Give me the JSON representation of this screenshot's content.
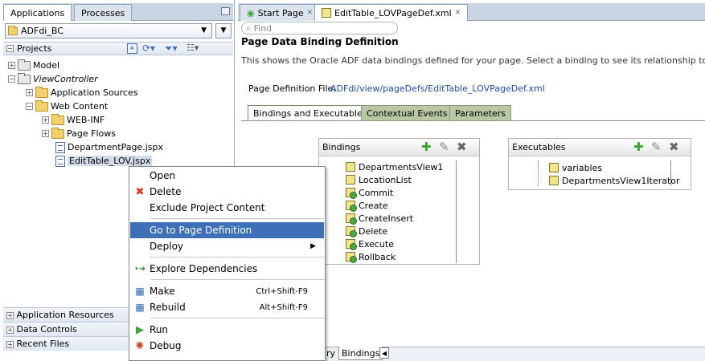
{
  "left_tabs": {
    "applications": "Applications",
    "processes": "Processes"
  },
  "app_selector": {
    "value": "ADFdi_BC"
  },
  "projects": {
    "title": "Projects"
  },
  "tree": {
    "model": "Model",
    "viewcontroller": "ViewController",
    "app_sources": "Application Sources",
    "web_content": "Web Content",
    "web_inf": "WEB-INF",
    "page_flows": "Page Flows",
    "department_page": "DepartmentPage.jspx",
    "edittable": "EditTable_LOV.jspx"
  },
  "accordions": [
    "Application Resources",
    "Data Controls",
    "Recent Files"
  ],
  "editor_tabs": {
    "start": "Start Page",
    "pagedef": "EditTable_LOVPageDef.xml"
  },
  "find": {
    "placeholder": "Find"
  },
  "pagedef": {
    "title": "Page Data Binding Definition",
    "description": "This shows the Oracle ADF data bindings defined for your page. Select a binding to see its relationship to the underlying",
    "file_label": "Page Definition File:",
    "file_path": "ADFdi/view/pageDefs/EditTable_LOVPageDef.xml"
  },
  "subtabs": {
    "bindings": "Bindings and Executables",
    "contextual": "Contextual Events",
    "parameters": "Parameters"
  },
  "bindings_panel": {
    "title": "Bindings",
    "items": [
      "DepartmentsView1",
      "LocationList",
      "Commit",
      "Create",
      "CreateInsert",
      "Delete",
      "Execute",
      "Rollback"
    ]
  },
  "executables_panel": {
    "title": "Executables",
    "items": [
      "variables",
      "DepartmentsView1Iterator"
    ]
  },
  "bottom_tabs": {
    "partial": "ry",
    "bindings": "Bindings"
  },
  "context_menu": {
    "open": "Open",
    "delete": "Delete",
    "exclude": "Exclude Project Content",
    "goto": "Go to Page Definition",
    "deploy": "Deploy",
    "explore": "Explore Dependencies",
    "make": "Make",
    "make_sc": "Ctrl+Shift-F9",
    "rebuild": "Rebuild",
    "rebuild_sc": "Alt+Shift-F9",
    "run": "Run",
    "debug": "Debug"
  },
  "colors": {
    "highlight": "#3d70b6",
    "link": "#1f4ea3",
    "add": "#3aa52f"
  }
}
